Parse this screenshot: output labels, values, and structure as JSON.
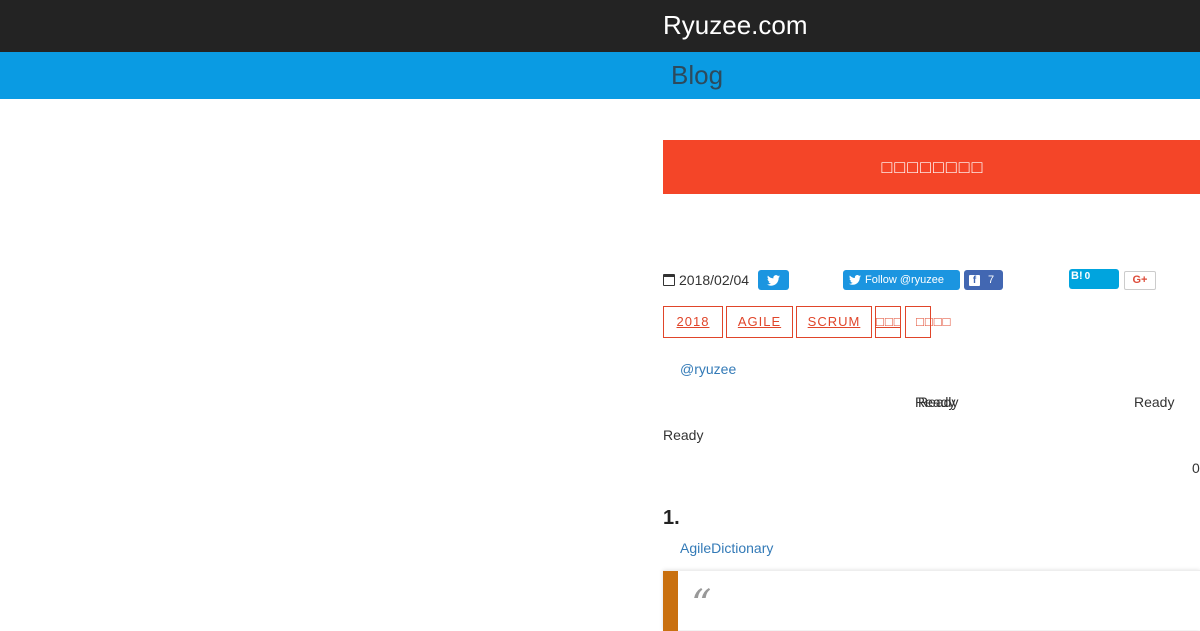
{
  "header": {
    "site_title": "Ryuzee.com",
    "section_title": "Blog"
  },
  "banner": {
    "label": "□□□□□□□□"
  },
  "post_meta": {
    "date": "2018/02/04",
    "follow_label": "Follow @ryuzee",
    "facebook_count": "7",
    "hatena_label": "B!",
    "hatena_count": "0",
    "gplus_label": "G+"
  },
  "tags": [
    "2018",
    "AGILE",
    "SCRUM",
    "□□□",
    "□□□□"
  ],
  "author_link": "@ryuzee",
  "status_texts": [
    "Ready",
    "Ready",
    "Ready",
    "Ready"
  ],
  "counter": "0",
  "section_heading": "1.",
  "dictionary_link": "AgileDictionary",
  "quote_mark": "“",
  "colors": {
    "topbar": "#232323",
    "subbar": "#0a9be3",
    "banner": "#f44528",
    "tag_accent": "#e0452a",
    "link": "#337ab7",
    "twitter": "#1b95e0",
    "facebook": "#4267b2",
    "hatena": "#00a4de",
    "quote_bar": "#c9700f"
  }
}
